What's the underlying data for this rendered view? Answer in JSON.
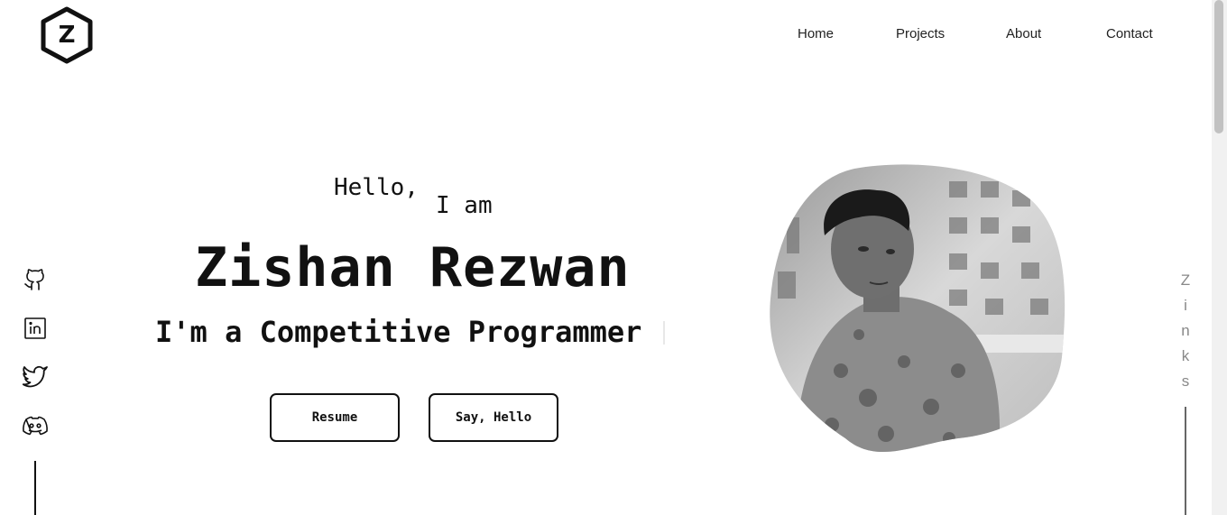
{
  "logo": {
    "letter": "Z"
  },
  "nav": {
    "items": [
      {
        "label": "Home"
      },
      {
        "label": "Projects"
      },
      {
        "label": "About"
      },
      {
        "label": "Contact"
      }
    ]
  },
  "hero": {
    "greeting": "Hello,",
    "intro": "I am",
    "name": "Zishan Rezwan",
    "role": "I'm a Competitive Programmer",
    "buttons": {
      "resume": "Resume",
      "say_hello": "Say, Hello"
    }
  },
  "social": {
    "icons": [
      "github-icon",
      "linkedin-icon",
      "twitter-icon",
      "discord-icon"
    ]
  },
  "side_links": {
    "letters": [
      "Z",
      "i",
      "n",
      "k",
      "s"
    ]
  },
  "colors": {
    "text": "#111111",
    "muted": "#888888",
    "background": "#ffffff"
  }
}
